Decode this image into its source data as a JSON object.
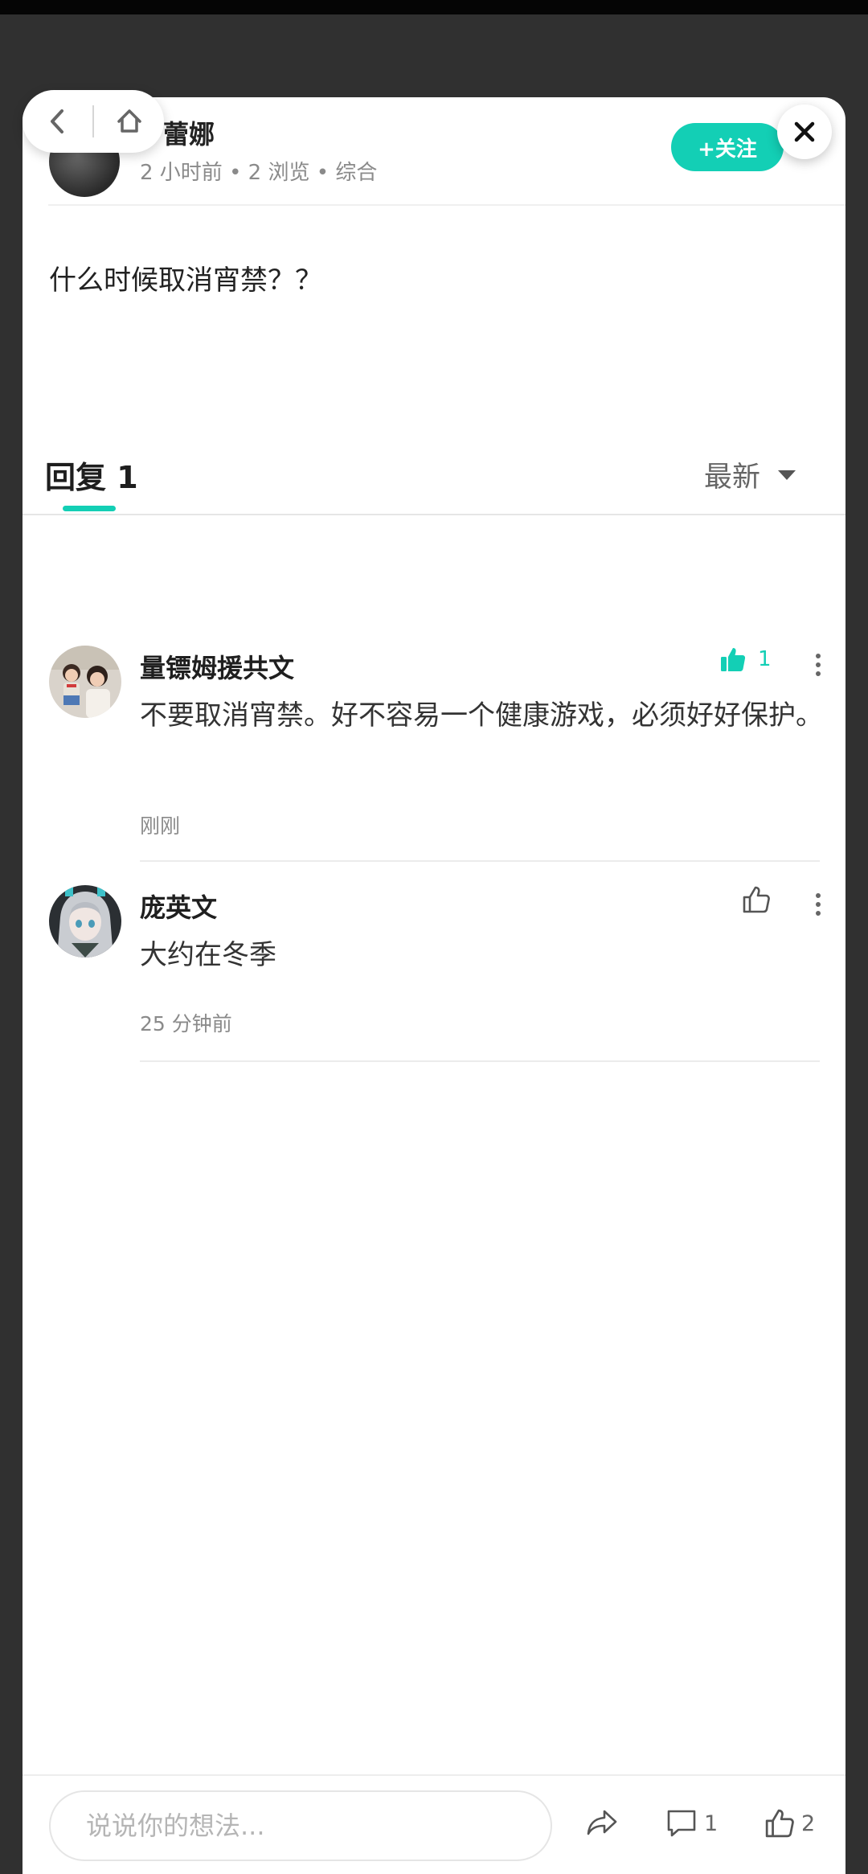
{
  "post": {
    "author_name": "蕾娜",
    "meta": "2 小时前 • 2 浏览 • 综合",
    "follow_label": "+关注",
    "body": "什么时候取消宵禁？？"
  },
  "replies": {
    "tab_label": "回复 1",
    "sort_label": "最新"
  },
  "comments": [
    {
      "name": "量镖姆援共文",
      "text": "不要取消宵禁。好不容易一个健康游戏，必须好好保护。",
      "time": "刚刚",
      "likes": "1",
      "liked": true
    },
    {
      "name": "庞英文",
      "text": "大约在冬季",
      "time": "25 分钟前",
      "likes": "",
      "liked": false
    }
  ],
  "bottom_bar": {
    "input_placeholder": "说说你的想法...",
    "comment_count": "1",
    "like_count": "2"
  },
  "icons": {
    "back": "chevron-left-icon",
    "home": "home-icon",
    "close": "close-icon",
    "share": "share-icon",
    "comment": "comment-icon",
    "like": "thumbs-up-icon",
    "more": "more-vertical-icon"
  },
  "colors": {
    "accent": "#13cfb5",
    "background": "#303030"
  }
}
